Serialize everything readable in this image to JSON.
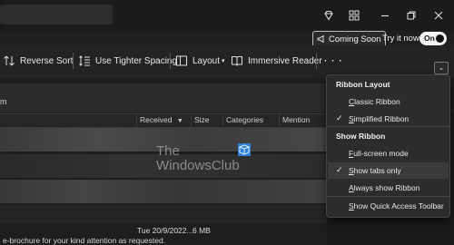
{
  "titlebar": {
    "icons": [
      "diamond-icon",
      "grid-apps-icon",
      "minimize-icon",
      "restore-icon",
      "close-icon"
    ]
  },
  "header": {
    "coming_soon_label": "Coming Soon",
    "try_it_now_label": "Try it now",
    "toggle_label": "On"
  },
  "ribbon": {
    "reverse_sort": "Reverse Sort",
    "tighter_spacing": "Use Tighter Spacing",
    "layout": "Layout",
    "immersive_reader": "Immersive Reader",
    "more": "· · ·"
  },
  "list": {
    "filter_partial": "m",
    "columns": [
      "Received",
      "Size",
      "Categories",
      "Mention"
    ],
    "bottom_row": {
      "received": "Tue 20/9/2022...",
      "size": "6 MB"
    },
    "preview_text": "e-brochure for your kind attention as requested."
  },
  "watermark": {
    "line1": "The",
    "line2": "WindowsClub"
  },
  "ribbon_menu": {
    "layout_heading": "Ribbon Layout",
    "classic": "Classic Ribbon",
    "simplified": "Simplified Ribbon",
    "show_heading": "Show Ribbon",
    "fullscreen": "Full-screen mode",
    "tabs_only": "Show tabs only",
    "always_show": "Always show Ribbon",
    "quick_access": "Show Quick Access Toolbar"
  },
  "colors": {
    "toggle_on": "#f2f2f2",
    "menu_bg": "#2c2c2c",
    "app_bg": "#1f1f1f"
  }
}
